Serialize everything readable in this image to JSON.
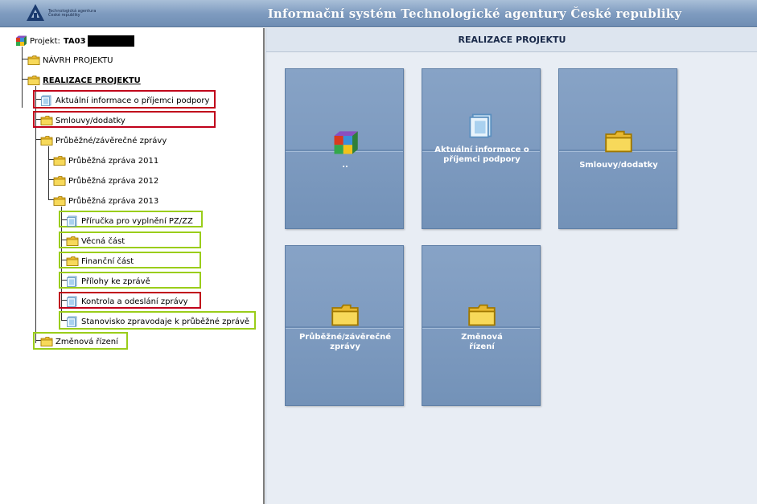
{
  "header": {
    "title": "Informační systém Technologické agentury České republiky",
    "logo_line1": "Technologická agentura",
    "logo_line2": "České republiky"
  },
  "tree": {
    "root_label": "Projekt:",
    "root_code": "TA03",
    "items": [
      {
        "label": "NÁVRH PROJEKTU"
      },
      {
        "label": "REALIZACE PROJEKTU"
      },
      {
        "label": "Aktuální informace o příjemci podpory"
      },
      {
        "label": "Smlouvy/dodatky"
      },
      {
        "label": "Průběžné/závěrečné zprávy"
      },
      {
        "label": "Průběžná zpráva 2011"
      },
      {
        "label": "Průběžná zpráva 2012"
      },
      {
        "label": "Průběžná zpráva 2013"
      },
      {
        "label": "Příručka pro vyplnění PZ/ZZ"
      },
      {
        "label": "Věcná část"
      },
      {
        "label": "Finanční část"
      },
      {
        "label": "Přílohy ke zprávě"
      },
      {
        "label": "Kontrola a odeslání zprávy"
      },
      {
        "label": "Stanovisko zpravodaje k průběžné zprávě"
      },
      {
        "label": "Změnová řízení"
      }
    ]
  },
  "main": {
    "heading": "REALIZACE PROJEKTU",
    "tiles": [
      {
        "label": ".."
      },
      {
        "label": "Aktuální informace o příjemci podpory"
      },
      {
        "label": "Smlouvy/dodatky"
      },
      {
        "label": "Průběžné/závěrečné zprávy"
      },
      {
        "label": "Změnová řízení"
      }
    ]
  },
  "colors": {
    "highlight_red": "#c0001a",
    "highlight_green": "#9acd1a",
    "tile_blue": "#7e9bc0"
  }
}
